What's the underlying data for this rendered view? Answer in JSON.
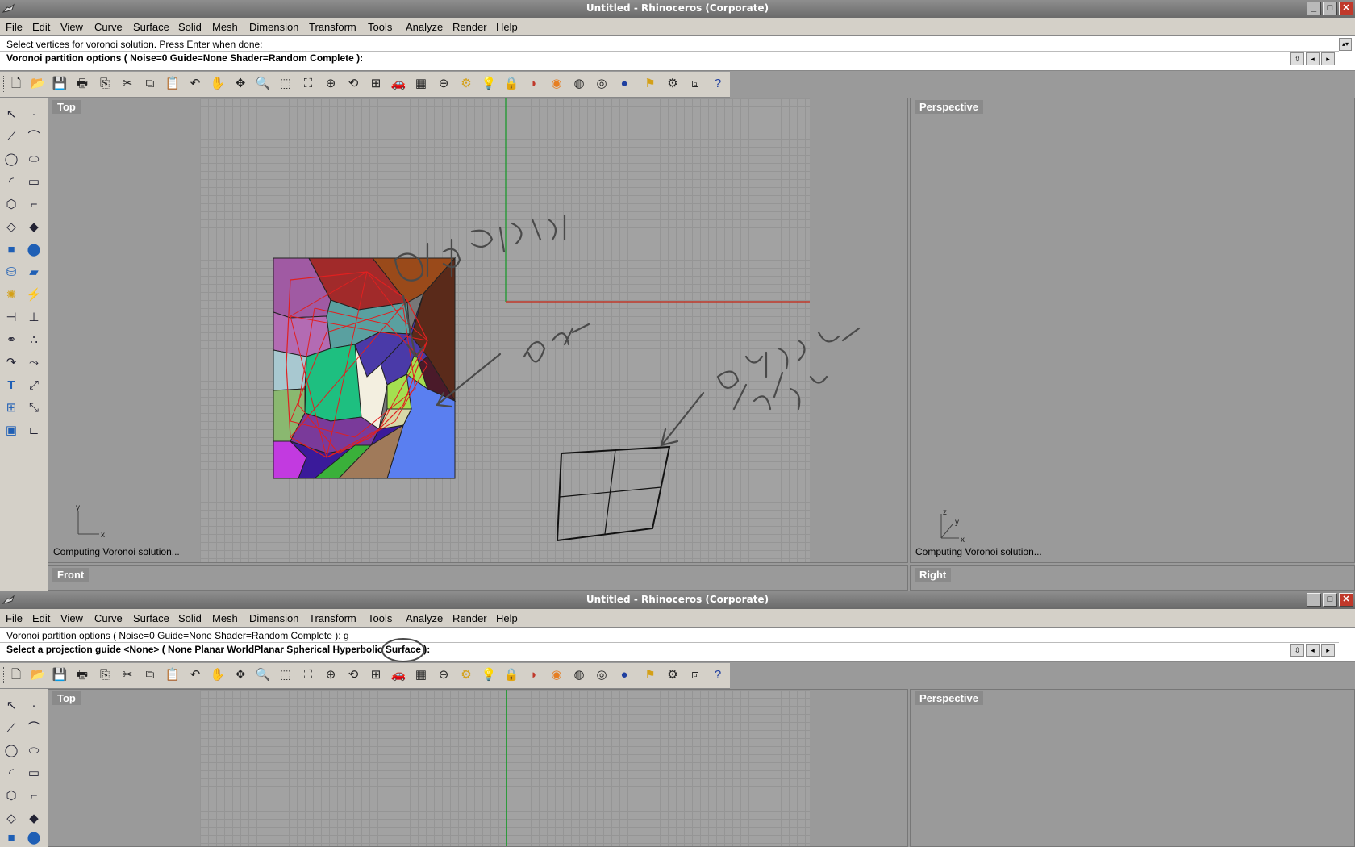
{
  "window": {
    "title": "Untitled - Rhinoceros (Corporate)",
    "min_label": "_",
    "max_label": "□",
    "close_label": "✕"
  },
  "menu": [
    "File",
    "Edit",
    "View",
    "Curve",
    "Surface",
    "Solid",
    "Mesh",
    "Dimension",
    "Transform",
    "Tools",
    "Analyze",
    "Render",
    "Help"
  ],
  "top": {
    "cmd_history": "Select vertices for voronoi solution. Press Enter when done:",
    "cmd_prompt": "Voronoi partition options ( Noise=0  Guide=None  Shader=Random  Complete ):",
    "viewports": {
      "top_label": "Top",
      "perspective_label": "Perspective",
      "front_label": "Front",
      "right_label": "Right",
      "top_status": "Computing Voronoi solution...",
      "perspective_status": "Computing Voronoi solution..."
    },
    "axes": {
      "x": "x",
      "y": "y",
      "z": "z"
    }
  },
  "bottom": {
    "cmd_history": "Voronoi partition options ( Noise=0  Guide=None  Shader=Random  Complete ): g",
    "cmd_prompt": "Select a projection guide <None> ( None  Planar  WorldPlanar  Spherical  Hyperbolic  Surface ):",
    "viewports": {
      "top_label": "Top",
      "perspective_label": "Perspective"
    }
  },
  "colors": {
    "viewport_bg": "#9a9a9a",
    "grid_line": "#959595",
    "x_axis": "#c0392b",
    "y_axis": "#2e9a3c",
    "annotation": "#4a4a4a",
    "chrome": "#d4d0c8"
  },
  "toolbar_icons": [
    "new-icon",
    "open-icon",
    "save-icon",
    "print-icon",
    "export-icon",
    "cut-icon",
    "copy-icon",
    "paste-icon",
    "undo-icon",
    "pan-icon",
    "rotate-view-icon",
    "zoom-icon",
    "zoom-window-icon",
    "zoom-extents-icon",
    "zoom-selected-icon",
    "undo-view-icon",
    "four-view-icon",
    "car-icon",
    "layer-icon",
    "osnap-icon",
    "properties-icon",
    "light-icon",
    "lock-icon",
    "shade-icon",
    "color-icon",
    "render-mesh-icon",
    "sphere-icon",
    "ball-icon",
    "flag-icon",
    "gear-icon",
    "plugin-icon",
    "help-icon"
  ],
  "left_toolbar_icons": [
    "select-icon",
    "point-icon",
    "polyline-icon",
    "curve-tools-icon",
    "circle-icon",
    "ellipse-icon",
    "arc-icon",
    "rectangle-icon",
    "polygon-icon",
    "fillet-icon",
    "surface-icon",
    "surface-tools-icon",
    "box-icon",
    "solid-tools-icon",
    "cylinder-icon",
    "mesh-icon",
    "light-tools-icon",
    "render-tools-icon",
    "transform-icon",
    "dimension-icon",
    "boolean-icon",
    "analyze-icon",
    "extend-icon",
    "offset-icon",
    "text-icon",
    "snap-icon",
    "array-icon",
    "scale-icon",
    "box-edit-icon",
    "group-icon"
  ]
}
